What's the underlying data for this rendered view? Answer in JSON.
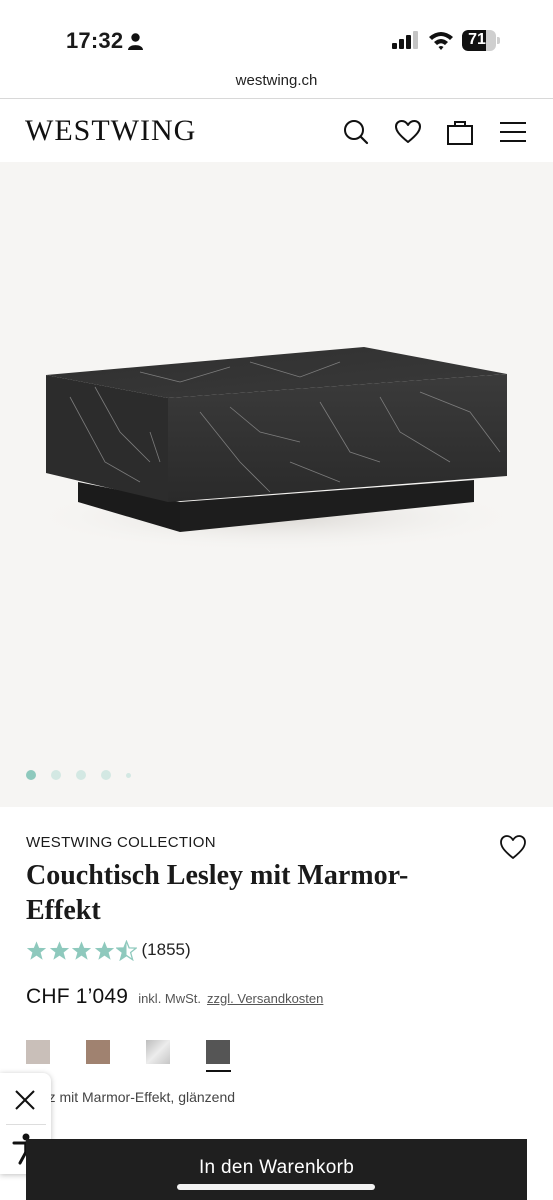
{
  "status_bar": {
    "time": "17:32",
    "battery_level": "71",
    "icons": [
      "person-icon",
      "signal-icon",
      "wifi-icon",
      "battery-icon"
    ]
  },
  "browser": {
    "url": "westwing.ch"
  },
  "header": {
    "logo": "WESTWING",
    "icons": [
      "search-icon",
      "heart-icon",
      "bag-icon",
      "menu-icon"
    ]
  },
  "gallery": {
    "image_count": 5,
    "active_index": 0,
    "image": "black-marble-coffee-table"
  },
  "product": {
    "brand": "WESTWING COLLECTION",
    "title": "Couchtisch Lesley mit Marmor-Effekt",
    "rating": 4.5,
    "rating_max": 5,
    "review_count": "(1855)",
    "price": "CHF 1’049",
    "tax_note": "inkl. MwSt.",
    "shipping_link": "zzgl. Versandkosten",
    "variant_label": "warz mit Marmor-Effekt, glänzend",
    "swatches": [
      {
        "name": "light-beige-marble",
        "color": "#c9bfb9"
      },
      {
        "name": "brown",
        "color": "#a08270"
      },
      {
        "name": "light-marble",
        "color": "#d2d2d2"
      },
      {
        "name": "black-marble",
        "color": "#555555",
        "selected": true
      }
    ]
  },
  "colors": {
    "accent_green": "#8ec9bd",
    "star": "#8ec9bd",
    "button_bg": "#1f1f1f",
    "hero_bg": "#f6f5f3"
  },
  "cta": {
    "add_to_cart": "In den Warenkorb"
  },
  "side_widget": {
    "icons": [
      "close-icon",
      "accessibility-icon"
    ]
  }
}
